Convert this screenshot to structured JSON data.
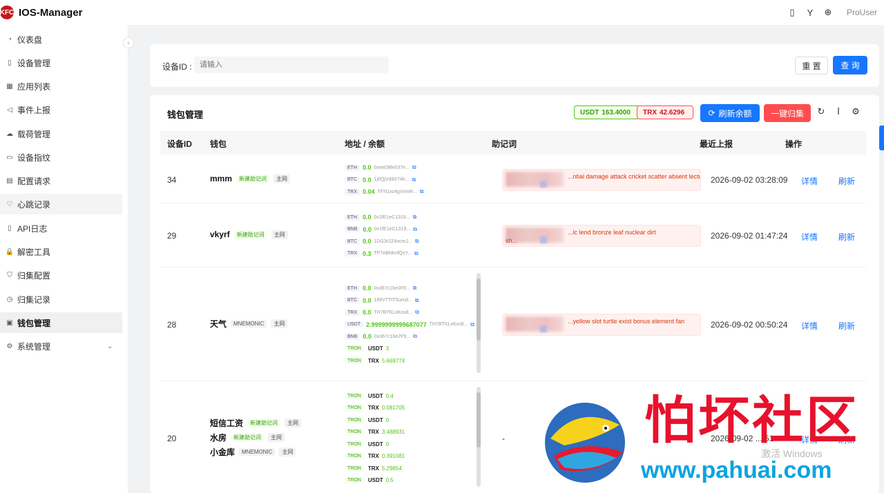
{
  "app": {
    "title": "IOS-Manager",
    "user": "ProUser",
    "logo_text": "KFC"
  },
  "sidebar": {
    "items": [
      {
        "label": "仪表盘",
        "icon": "dashboard-icon"
      },
      {
        "label": "设备管理",
        "icon": "phone-icon"
      },
      {
        "label": "应用列表",
        "icon": "grid-icon"
      },
      {
        "label": "事件上报",
        "icon": "send-icon"
      },
      {
        "label": "载荷管理",
        "icon": "cloud-icon"
      },
      {
        "label": "设备指纹",
        "icon": "id-card-icon"
      },
      {
        "label": "配置请求",
        "icon": "config-icon"
      },
      {
        "label": "心跳记录",
        "icon": "heart-icon"
      },
      {
        "label": "API日志",
        "icon": "file-icon"
      },
      {
        "label": "解密工具",
        "icon": "lock-icon"
      },
      {
        "label": "归集配置",
        "icon": "shield-icon"
      },
      {
        "label": "归集记录",
        "icon": "clock-icon"
      },
      {
        "label": "钱包管理",
        "icon": "wallet-icon"
      },
      {
        "label": "系统管理",
        "icon": "gear-icon"
      }
    ]
  },
  "search": {
    "label": "设备ID :",
    "placeholder": "请输入",
    "reset": "重 置",
    "query": "查 询"
  },
  "wallet": {
    "title": "钱包管理",
    "usdt_label": "USDT",
    "usdt_value": "163.4000",
    "trx_label": "TRX",
    "trx_value": "42.6296",
    "refresh_label": "刷新余额",
    "collect_label": "一键归集",
    "columns": [
      "设备ID",
      "钱包",
      "地址 / 余额",
      "助记词",
      "最近上报",
      "操作"
    ],
    "action_detail": "详情",
    "action_refresh": "刷新",
    "rows": [
      {
        "id": "34",
        "wallets": [
          {
            "name": "mmm",
            "tags": [
              "新建助记词",
              "主网"
            ]
          }
        ],
        "addresses": [
          {
            "chain": "ETH",
            "amount": "0.0",
            "addr": "0xeeD8fe037e..."
          },
          {
            "chain": "BTC",
            "amount": "0.0",
            "addr": "1j8QjVd9X74h..."
          },
          {
            "chain": "TRX",
            "amount": "0.04",
            "addr": "TFN1xz4gVxmR..."
          }
        ],
        "mnemonic": "...ntial damage attack cricket scatter absent lecture",
        "time": "2026-09-02 03:28:09"
      },
      {
        "id": "29",
        "wallets": [
          {
            "name": "vkyrf",
            "tags": [
              "新建助记词",
              "主网"
            ]
          }
        ],
        "addresses": [
          {
            "chain": "ETH",
            "amount": "0.0",
            "addr": "0x1fE1eC1319..."
          },
          {
            "chain": "BNB",
            "amount": "0.0",
            "addr": "0x1fE1eC1319..."
          },
          {
            "chain": "BTC",
            "amount": "0.0",
            "addr": "1DG3r2Z4ocmJ..."
          },
          {
            "chain": "TRX",
            "amount": "0.3",
            "addr": "TP7eBNknfQsY..."
          }
        ],
        "mnemonic": "...ic lend bronze leaf nuclear dirt",
        "mnemonic2": "sh...",
        "time": "2026-09-02 01:47:24"
      },
      {
        "id": "28",
        "wallets": [
          {
            "name": "天气",
            "tags": [
              "MNEMONIC",
              "主网"
            ]
          }
        ],
        "addresses": [
          {
            "chain": "ETH",
            "amount": "0.0",
            "addr": "0x367c16e2F9..."
          },
          {
            "chain": "BTC",
            "amount": "0.0",
            "addr": "189VTTtTSumd..."
          },
          {
            "chain": "TRX",
            "amount": "0.0",
            "addr": "TH7BTKLxKxs8..."
          },
          {
            "chain": "USDT",
            "amount": "2.9999999999687077",
            "addr": "TH7BTKLxKxs8..."
          },
          {
            "chain": "BNB",
            "amount": "0.0",
            "addr": "0x367c16e2F9..."
          }
        ],
        "tokens": [
          {
            "net": "TRON",
            "token": "USDT",
            "value": "3"
          },
          {
            "net": "TRON",
            "token": "TRX",
            "value": "5.669774"
          }
        ],
        "mnemonic": "...yellow slot turtle exist bonus element fan",
        "time": "2026-09-02 00:50:24"
      },
      {
        "id": "20",
        "wallets": [
          {
            "name": "短信工资",
            "tags": [
              "新建助记词",
              "主网"
            ]
          },
          {
            "name": "水房",
            "tags": [
              "新建助记词",
              "主网"
            ]
          },
          {
            "name": "小金库",
            "tags": [
              "MNEMONIC",
              "主网"
            ]
          }
        ],
        "tokens": [
          {
            "net": "TRON",
            "token": "USDT",
            "value": "0.4"
          },
          {
            "net": "TRON",
            "token": "TRX",
            "value": "0.081705"
          },
          {
            "net": "TRON",
            "token": "USDT",
            "value": "0"
          },
          {
            "net": "TRON",
            "token": "TRX",
            "value": "3.488931"
          },
          {
            "net": "TRON",
            "token": "USDT",
            "value": "0"
          },
          {
            "net": "TRON",
            "token": "TRX",
            "value": "0.391081"
          },
          {
            "net": "TRON",
            "token": "TRX",
            "value": "5.29854"
          },
          {
            "net": "TRON",
            "token": "USDT",
            "value": "0.5"
          }
        ],
        "mnemonic": "-",
        "time": "2026-09-02 ...:51"
      }
    ]
  },
  "watermark": {
    "title": "怕坏社区",
    "url": "www.pahuai.com",
    "windows": "激活 Windows"
  },
  "colors": {
    "primary": "#1677ff",
    "danger": "#ff4d4f",
    "success": "#52c41a"
  }
}
